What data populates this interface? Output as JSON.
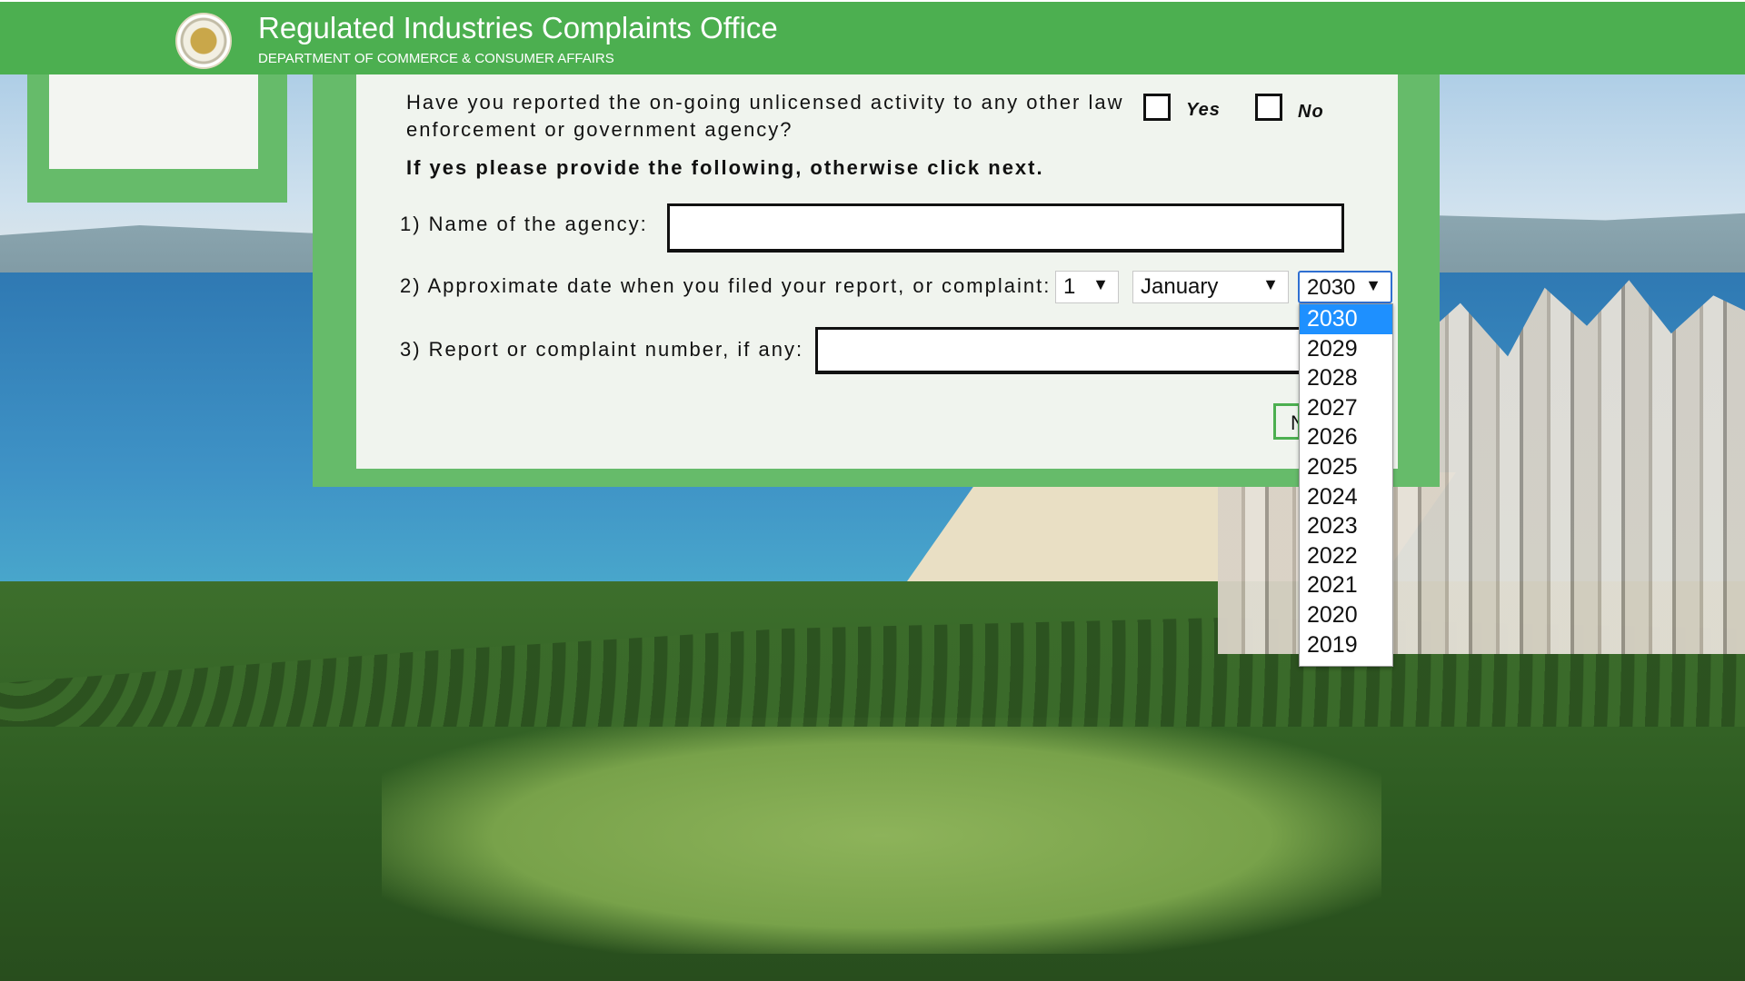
{
  "header": {
    "title": "Regulated Industries Complaints Office",
    "subtitle": "DEPARTMENT OF COMMERCE & CONSUMER AFFAIRS"
  },
  "form": {
    "question_main": "Have you reported the on-going unlicensed activity to any other law enforcement or government agency?",
    "yes_label": "Yes",
    "no_label": "No",
    "instruction": "If yes please provide the following, otherwise click next.",
    "q1_label": "1) Name of the agency:",
    "q1_value": "",
    "q2_label": "2) Approximate date when you filed your report, or complaint:",
    "day_value": "1",
    "month_value": "January",
    "year_value": "2030",
    "q3_label": "3) Report or complaint number, if any:",
    "q3_value": "",
    "next_label": "N"
  },
  "year_dropdown": {
    "selected": "2030",
    "options": [
      "2030",
      "2029",
      "2028",
      "2027",
      "2026",
      "2025",
      "2024",
      "2023",
      "2022",
      "2021",
      "2020",
      "2019"
    ]
  },
  "colors": {
    "header_green": "#4caf50",
    "panel_green": "#66bb6a",
    "option_highlight": "#1e90ff"
  }
}
